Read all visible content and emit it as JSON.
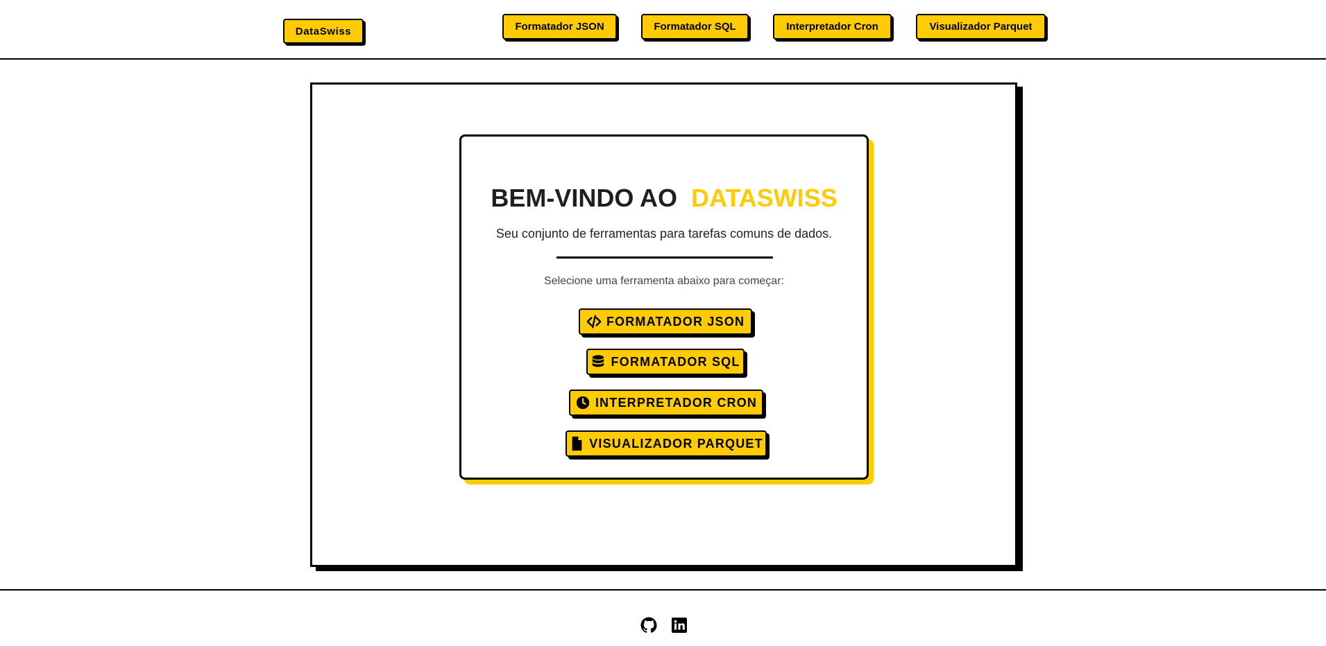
{
  "header": {
    "brand_label": "DataSwiss",
    "nav": [
      {
        "label": "Formatador JSON"
      },
      {
        "label": "Formatador SQL"
      },
      {
        "label": "Interpretador Cron"
      },
      {
        "label": "Visualizador Parquet"
      }
    ]
  },
  "card": {
    "title_main": "BEM-VINDO AO",
    "title_accent": "DATASWISS",
    "subtitle": "Seu conjunto de ferramentas para tarefas comuns de dados.",
    "prompt": "Selecione uma ferramenta abaixo para começar:",
    "tools": [
      {
        "label": "FORMATADOR JSON",
        "icon": "code-icon"
      },
      {
        "label": "FORMATADOR SQL",
        "icon": "database-icon"
      },
      {
        "label": "INTERPRETADOR CRON",
        "icon": "clock-icon"
      },
      {
        "label": "VISUALIZADOR PARQUET",
        "icon": "file-icon"
      }
    ]
  },
  "footer": {
    "links": [
      {
        "icon": "github-icon"
      },
      {
        "icon": "linkedin-icon"
      }
    ]
  },
  "colors": {
    "accent": "#ffcb05",
    "border": "#000000",
    "text": "#1f1f1f"
  }
}
